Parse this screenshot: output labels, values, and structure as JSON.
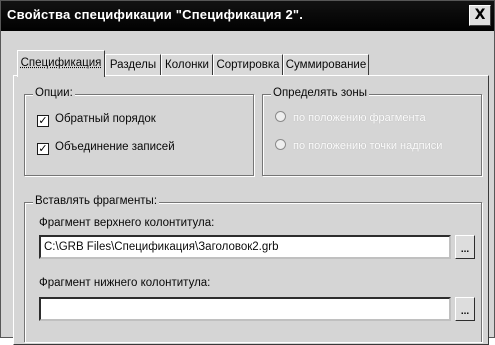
{
  "window": {
    "title": "Свойства спецификации \"Спецификация 2\".",
    "close_glyph": "X"
  },
  "tabs": [
    {
      "label": "Спецификация",
      "active": true
    },
    {
      "label": "Разделы",
      "active": false
    },
    {
      "label": "Колонки",
      "active": false
    },
    {
      "label": "Сортировка",
      "active": false
    },
    {
      "label": "Суммирование",
      "active": false
    }
  ],
  "options": {
    "legend": "Опции",
    "reverse_order": {
      "label": "Обратный порядок",
      "checked": true
    },
    "merge_records": {
      "label": "Объединение записей",
      "checked": true
    }
  },
  "zones": {
    "legend": "Определять зоны",
    "by_fragment": {
      "label": "по положению фрагмента",
      "selected": false,
      "enabled": false
    },
    "by_title_block": {
      "label": "по положению точки надписи",
      "selected": false,
      "enabled": false
    }
  },
  "insert_fragments": {
    "legend": "Вставлять фрагменты",
    "header": {
      "label": "Фрагмент верхнего колонтитула:",
      "value": "C:\\GRB Files\\Спецификация\\Заголовок2.grb",
      "browse": "..."
    },
    "footer": {
      "label": "Фрагмент нижнего колонтитула:",
      "value": "",
      "browse": "..."
    }
  },
  "check_glyph": "✓"
}
